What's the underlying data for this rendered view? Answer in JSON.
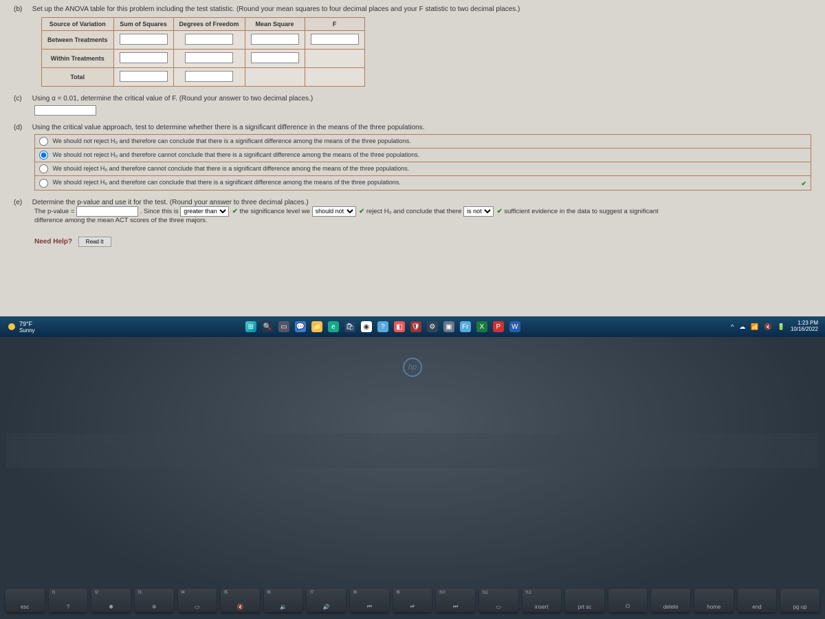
{
  "b": {
    "label": "(b)",
    "prompt": "Set up the ANOVA table for this problem including the test statistic. (Round your mean squares to four decimal places and your F statistic to two decimal places.)",
    "headers": [
      "Source of Variation",
      "Sum of Squares",
      "Degrees of Freedom",
      "Mean Square",
      "F"
    ],
    "rows": [
      "Between Treatments",
      "Within Treatments",
      "Total"
    ]
  },
  "c": {
    "label": "(c)",
    "prompt": "Using α = 0.01, determine the critical value of F. (Round your answer to two decimal places.)"
  },
  "d": {
    "label": "(d)",
    "prompt": "Using the critical value approach, test to determine whether there is a significant difference in the means of the three populations.",
    "options": [
      "We should not reject H₀ and therefore can conclude that there is a significant difference among the means of the three populations.",
      "We should not reject H₀ and therefore cannot conclude that there is a significant difference among the means of the three populations.",
      "We should reject H₀ and therefore cannot conclude that there is a significant difference among the means of the three populations.",
      "We should reject H₀ and therefore can conclude that there is a significant difference among the means of the three populations."
    ],
    "selected": 1
  },
  "e": {
    "label": "(e)",
    "prompt": "Determine the p-value and use it for the test. (Round your answer to three decimal places.)",
    "l1a": "The p-value = ",
    "l1b": ". Since this is ",
    "sel1": "greater than",
    "l1c": " the significance level we ",
    "sel2": "should not",
    "l1d": " reject H₀ and conclude that there ",
    "sel3": "is not",
    "l1e": " sufficient evidence in the data to suggest a significant",
    "l2": "difference among the mean ACT scores of the three majors."
  },
  "help": {
    "label": "Need Help?",
    "btn": "Read It"
  },
  "taskbar": {
    "temp": "79°F",
    "cond": "Sunny",
    "time": "1:23 PM",
    "date": "10/16/2022"
  },
  "hp": "hp",
  "keys": [
    {
      "t": "",
      "b": "esc"
    },
    {
      "t": "f1",
      "b": "?"
    },
    {
      "t": "f2",
      "b": "✱"
    },
    {
      "t": "f3",
      "b": "✲"
    },
    {
      "t": "f4",
      "b": "▭"
    },
    {
      "t": "f5",
      "b": "🔇"
    },
    {
      "t": "f6",
      "b": "🔉"
    },
    {
      "t": "f7",
      "b": "🔊"
    },
    {
      "t": "f8",
      "b": "⏮"
    },
    {
      "t": "f9",
      "b": "⏯"
    },
    {
      "t": "f10",
      "b": "⏭"
    },
    {
      "t": "f11",
      "b": "▭"
    },
    {
      "t": "f12",
      "b": "insert"
    },
    {
      "t": "",
      "b": "prt sc"
    },
    {
      "t": "",
      "b": "⏻"
    },
    {
      "t": "",
      "b": "delete"
    },
    {
      "t": "",
      "b": "home"
    },
    {
      "t": "",
      "b": "end"
    },
    {
      "t": "",
      "b": "pg up"
    }
  ]
}
